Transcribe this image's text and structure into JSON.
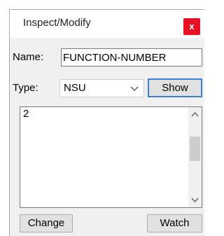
{
  "window": {
    "title": "Inspect/Modify",
    "close_label": "x"
  },
  "form": {
    "name_label": "Name:",
    "name_value": "FUNCTION-NUMBER",
    "type_label": "Type:",
    "type_value": "NSU",
    "show_label": "Show"
  },
  "value_area": {
    "text": "2"
  },
  "buttons": {
    "change_label": "Change",
    "watch_label": "Watch"
  },
  "colors": {
    "close_bg": "#e81123",
    "focus_border": "#3c7fd6",
    "panel_bg": "#f0f0f0"
  }
}
